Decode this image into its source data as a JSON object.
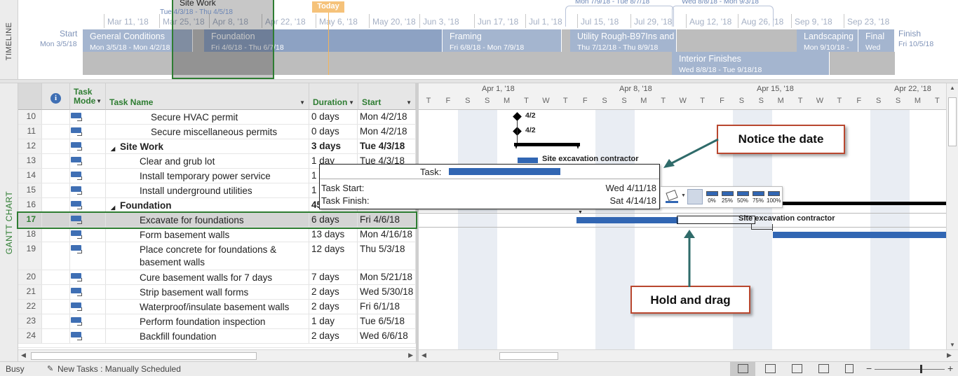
{
  "timeline": {
    "label": "TIMELINE",
    "start_label": "Start",
    "start_date": "Mon 3/5/18",
    "finish_label": "Finish",
    "finish_date": "Fri 10/5/18",
    "today_label": "Today",
    "ticks": [
      "Mar 11, '18",
      "Mar 25, '18",
      "Apr 8, '18",
      "Apr 22, '18",
      "May 6, '18",
      "May 20, '18",
      "Jun 3, '18",
      "Jun 17, '18",
      "Jul 1, '18",
      "Jul 15, '18",
      "Jul 29, '18",
      "Aug 12, '18",
      "Aug 26, '18",
      "Sep 9, '18",
      "Sep 23, '18"
    ],
    "bars": [
      {
        "name": "General Conditions",
        "dates": "Mon 3/5/18 - Mon 4/2/18"
      },
      {
        "name": "Foundation",
        "dates": "Fri 4/6/18 - Thu 6/7/18"
      },
      {
        "name": "Framing",
        "dates": "Fri 6/8/18 - Mon 7/9/18"
      },
      {
        "name": "Utility Rough-B97Ins and",
        "dates": "Thu 7/12/18 - Thu 8/9/18"
      },
      {
        "name": "Landscaping",
        "dates": "Mon 9/10/18 -"
      },
      {
        "name": "Final",
        "dates": "Wed"
      },
      {
        "name": "Interior Finishes",
        "dates": "Wed 8/8/18 - Tue 9/18/18"
      }
    ],
    "callouts": [
      {
        "name": "Site Work",
        "dates": "Tue 4/3/18 - Thu 4/5/18"
      },
      {
        "name": "",
        "dates": "Mon 7/9/18 - Tue 8/7/18"
      },
      {
        "name": "",
        "dates": "Wed 8/8/18 - Mon 9/3/18"
      }
    ]
  },
  "table": {
    "side_label": "GANTT CHART",
    "headers": {
      "mode": "Task Mode",
      "name": "Task Name",
      "duration": "Duration",
      "start": "Start"
    },
    "rows": [
      {
        "id": "10",
        "name": "Secure HVAC permit",
        "duration": "0 days",
        "start": "Mon 4/2/18",
        "summary": false
      },
      {
        "id": "11",
        "name": "Secure miscellaneous permits",
        "duration": "0 days",
        "start": "Mon 4/2/18",
        "summary": false
      },
      {
        "id": "12",
        "name": "Site Work",
        "duration": "3 days",
        "start": "Tue 4/3/18",
        "summary": true
      },
      {
        "id": "13",
        "name": "Clear and grub lot",
        "duration": "1 day",
        "start": "Tue 4/3/18",
        "summary": false
      },
      {
        "id": "14",
        "name": "Install temporary power service",
        "duration": "1",
        "start": "",
        "summary": false
      },
      {
        "id": "15",
        "name": "Install underground utilities",
        "duration": "1",
        "start": "",
        "summary": false
      },
      {
        "id": "16",
        "name": "Foundation",
        "duration": "45",
        "start": "",
        "summary": true
      },
      {
        "id": "17",
        "name": "Excavate for foundations",
        "duration": "6 days",
        "start": "Fri 4/6/18",
        "summary": false
      },
      {
        "id": "18",
        "name": "Form basement walls",
        "duration": "13 days",
        "start": "Mon 4/16/18",
        "summary": false
      },
      {
        "id": "19",
        "name": "Place concrete for foundations &",
        "name2": "basement walls",
        "duration": "12 days",
        "start": "Thu 5/3/18",
        "summary": false
      },
      {
        "id": "20",
        "name": "Cure basement walls for 7 days",
        "duration": "7 days",
        "start": "Mon 5/21/18",
        "summary": false
      },
      {
        "id": "21",
        "name": "Strip basement wall forms",
        "duration": "2 days",
        "start": "Wed 5/30/18",
        "summary": false
      },
      {
        "id": "22",
        "name": "Waterproof/insulate basement walls",
        "duration": "2 days",
        "start": "Fri 6/1/18",
        "summary": false
      },
      {
        "id": "23",
        "name": "Perform foundation inspection",
        "duration": "1 day",
        "start": "Tue 6/5/18",
        "summary": false
      },
      {
        "id": "24",
        "name": "Backfill foundation",
        "duration": "2 days",
        "start": "Wed 6/6/18",
        "summary": false
      }
    ]
  },
  "gantt": {
    "weeks": [
      "Apr 1, '18",
      "Apr 8, '18",
      "Apr 15, '18",
      "Apr 22, '18"
    ],
    "days": [
      "T",
      "F",
      "S",
      "S",
      "M",
      "T",
      "W",
      "T",
      "F",
      "S",
      "S",
      "M",
      "T",
      "W",
      "T",
      "F",
      "S",
      "S",
      "M",
      "T",
      "W",
      "T",
      "F",
      "S",
      "S",
      "M",
      "T"
    ],
    "milestone_labels": [
      "4/2",
      "4/2"
    ],
    "resource_label_1": "Site excavation contractor",
    "resource_label_2": "Site excavation contractor"
  },
  "tooltip": {
    "task_label": "Task:",
    "start_label": "Task Start:",
    "start_value": "Wed 4/11/18",
    "finish_label": "Task Finish:",
    "finish_value": "Sat 4/14/18"
  },
  "mini_toolbar": {
    "pct": [
      "0%",
      "25%",
      "50%",
      "75%",
      "100%"
    ]
  },
  "callouts": {
    "notice": "Notice the date",
    "drag": "Hold and drag"
  },
  "status_bar": {
    "state": "Busy",
    "new_tasks": "New Tasks : Manually Scheduled"
  },
  "colors": {
    "bar": "#3166b3",
    "timeline_bar": "#a4b5cf",
    "green": "#2e7d32",
    "callout_border": "#b9472f"
  }
}
